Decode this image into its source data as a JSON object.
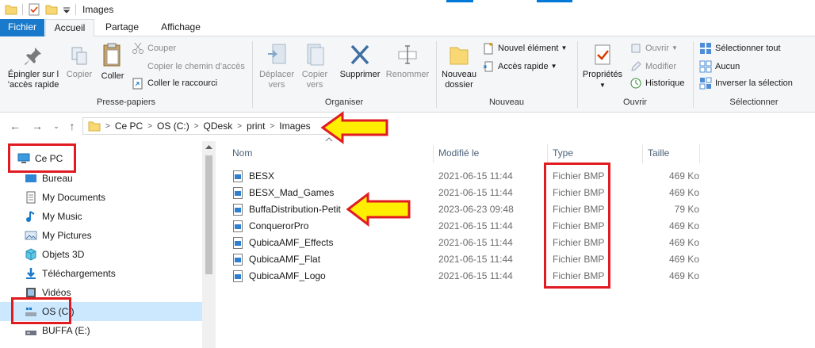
{
  "window": {
    "title": "Images"
  },
  "ribbon_tabs": [
    "Fichier",
    "Accueil",
    "Partage",
    "Affichage"
  ],
  "ribbon": {
    "clipboard": {
      "label": "Presse-papiers",
      "pin": "Épingler sur l’accès rapide",
      "pin_l1": "Épingler sur l",
      "pin_l2": "’accès rapide",
      "copy": "Copier",
      "paste": "Coller",
      "cut": "Couper",
      "copy_path": "Copier le chemin d’accès",
      "paste_shortcut": "Coller le raccourci"
    },
    "organize": {
      "label": "Organiser",
      "move_l1": "Déplacer",
      "move_l2": "vers",
      "copyto_l1": "Copier",
      "copyto_l2": "vers",
      "delete": "Supprimer",
      "rename": "Renommer"
    },
    "new": {
      "label": "Nouveau",
      "new_folder_l1": "Nouveau",
      "new_folder_l2": "dossier",
      "new_item": "Nouvel élément",
      "quick_access": "Accès rapide"
    },
    "open": {
      "label": "Ouvrir",
      "properties": "Propriétés",
      "open": "Ouvrir",
      "edit": "Modifier",
      "history": "Historique"
    },
    "select": {
      "label": "Sélectionner",
      "select_all": "Sélectionner tout",
      "select_none": "Aucun",
      "invert": "Inverser la sélection"
    }
  },
  "breadcrumb": [
    "Ce PC",
    "OS (C:)",
    "QDesk",
    "print",
    "Images"
  ],
  "nav_pane": [
    {
      "label": "Ce PC",
      "icon": "computer-icon"
    },
    {
      "label": "Bureau",
      "icon": "desktop-folder-icon"
    },
    {
      "label": "My Documents",
      "icon": "documents-icon"
    },
    {
      "label": "My Music",
      "icon": "music-icon"
    },
    {
      "label": "My Pictures",
      "icon": "pictures-icon"
    },
    {
      "label": "Objets 3D",
      "icon": "cube-3d-icon"
    },
    {
      "label": "Téléchargements",
      "icon": "download-icon"
    },
    {
      "label": "Vidéos",
      "icon": "video-icon"
    },
    {
      "label": "OS (C:)",
      "icon": "drive-icon"
    },
    {
      "label": "BUFFA (E:)",
      "icon": "usb-drive-icon"
    }
  ],
  "columns": {
    "name": "Nom",
    "modified": "Modifié le",
    "type": "Type",
    "size": "Taille"
  },
  "files": [
    {
      "name": "BESX",
      "modified": "2021-06-15 11:44",
      "type": "Fichier BMP",
      "size": "469 Ko"
    },
    {
      "name": "BESX_Mad_Games",
      "modified": "2021-06-15 11:44",
      "type": "Fichier BMP",
      "size": "469 Ko"
    },
    {
      "name": "BuffaDistribution-Petit",
      "modified": "2023-06-23 09:48",
      "type": "Fichier BMP",
      "size": "79 Ko"
    },
    {
      "name": "ConquerorPro",
      "modified": "2021-06-15 11:44",
      "type": "Fichier BMP",
      "size": "469 Ko"
    },
    {
      "name": "QubicaAMF_Effects",
      "modified": "2021-06-15 11:44",
      "type": "Fichier BMP",
      "size": "469 Ko"
    },
    {
      "name": "QubicaAMF_Flat",
      "modified": "2021-06-15 11:44",
      "type": "Fichier BMP",
      "size": "469 Ko"
    },
    {
      "name": "QubicaAMF_Logo",
      "modified": "2021-06-15 11:44",
      "type": "Fichier BMP",
      "size": "469 Ko"
    }
  ],
  "colors": {
    "accent": "#1979ca",
    "annotation_red": "#e11b22",
    "annotation_yellow": "#ffee00"
  }
}
